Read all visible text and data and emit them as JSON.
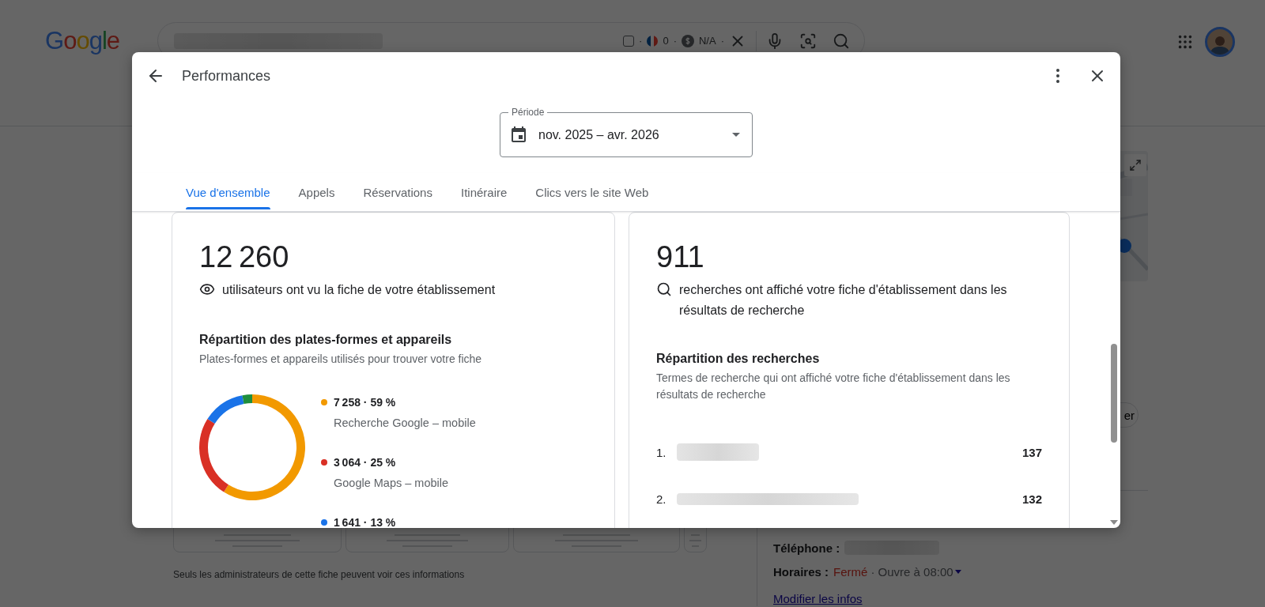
{
  "page": {
    "logo": "Google",
    "search_bar": {
      "extension": [
        {
          "kind": "checkbox",
          "checked": false
        },
        {
          "kind": "text",
          "text": "·"
        },
        {
          "kind": "flag"
        },
        {
          "kind": "text",
          "text": "0"
        },
        {
          "kind": "text",
          "text": "·"
        },
        {
          "kind": "dollar"
        },
        {
          "kind": "text",
          "text": "N/A"
        },
        {
          "kind": "text",
          "text": "·"
        }
      ]
    },
    "map_button": "er",
    "notice": "Seuls les administrateurs de cette fiche peuvent voir ces informations",
    "phone": {
      "label": "Téléphone :"
    },
    "hours": {
      "label": "Horaires :",
      "status": "Fermé",
      "next": "· Ouvre à 08:00"
    },
    "edit_link": "Modifier les infos"
  },
  "dialog": {
    "title": "Performances",
    "period": {
      "label": "Période",
      "value": "nov. 2025 – avr. 2026"
    },
    "tabs": [
      {
        "label": "Vue d'ensemble",
        "selected": true
      },
      {
        "label": "Appels",
        "selected": false
      },
      {
        "label": "Réservations",
        "selected": false
      },
      {
        "label": "Itinéraire",
        "selected": false
      },
      {
        "label": "Clics vers le site Web",
        "selected": false
      }
    ],
    "cards": [
      {
        "kind": "views",
        "total": "12 260",
        "caption": "utilisateurs ont vu la fiche de votre établissement",
        "heading": "Répartition des plates-formes et appareils",
        "subheading": "Plates-formes et appareils utilisés pour trouver votre fiche",
        "legend": [
          {
            "value": "7 258 · 59 %",
            "label": "Recherche Google – mobile",
            "color": "#f29900"
          },
          {
            "value": "3 064 · 25 %",
            "label": "Google Maps – mobile",
            "color": "#d93025"
          },
          {
            "value": "1 641 · 13 %",
            "color": "#1a73e8"
          }
        ],
        "chart_data": {
          "type": "donut",
          "values": [
            59,
            25,
            13,
            3
          ],
          "colors": [
            "#f29900",
            "#d93025",
            "#1a73e8",
            "#1e8e3e"
          ]
        }
      },
      {
        "kind": "searches",
        "total": "911",
        "caption": "recherches ont affiché votre fiche d'établissement dans les résultats de recherche",
        "heading": "Répartition des recherches",
        "subheading": "Termes de recherche qui ont affiché votre fiche d'établissement dans les résultats de recherche",
        "terms": [
          {
            "rank": "1.",
            "count": "137"
          },
          {
            "rank": "2.",
            "count": "132"
          }
        ]
      }
    ]
  }
}
